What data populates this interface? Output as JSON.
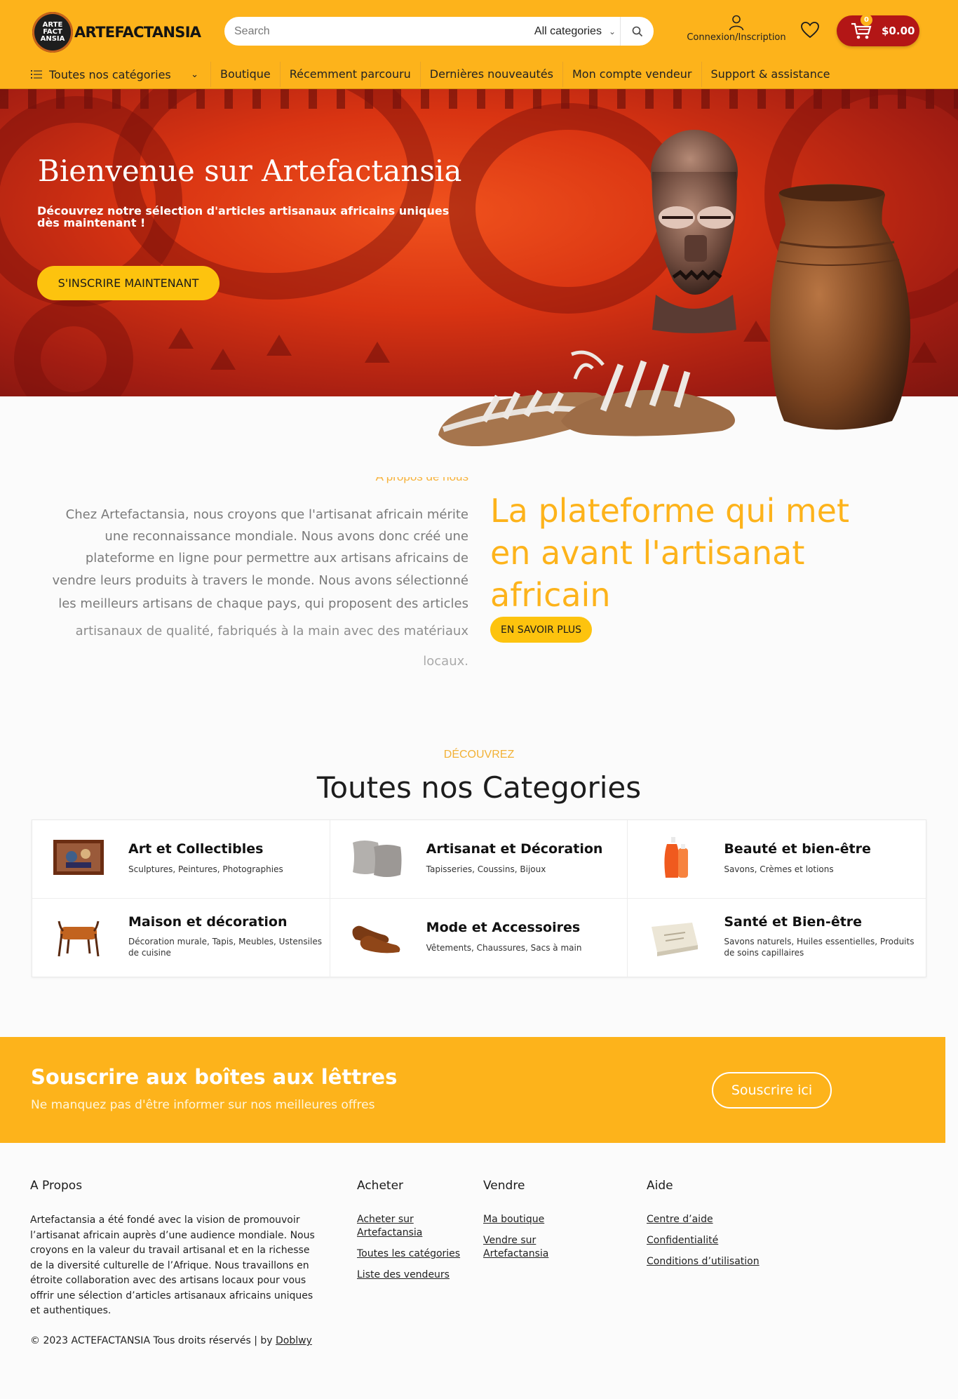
{
  "header": {
    "logo_text": "ARTEFACTANSIA",
    "logo_badge": [
      "ARTE",
      "FACT",
      "ANSIA"
    ],
    "search_placeholder": "Search",
    "category_select": "All categories",
    "account_label": "Connexion/Inscription",
    "cart_count": "0",
    "cart_amount": "$0.00",
    "colors": {
      "brand_yellow": "#fdb31b",
      "cart_red": "#b31616"
    }
  },
  "nav": {
    "all_categories": "Toutes nos catégories",
    "links": [
      "Boutique",
      "Récemment parcouru",
      "Dernières nouveautés",
      "Mon compte vendeur",
      "Support & assistance"
    ]
  },
  "hero": {
    "title": "Bienvenue sur Artefactansia",
    "subtitle": "Découvrez notre sélection d'articles artisanaux africains uniques dès maintenant !",
    "cta": "S'INSCRIRE MAINTENANT"
  },
  "about": {
    "label": "A propos de nous",
    "paragraph_lines": [
      "Chez Artefactansia, nous croyons que l'artisanat africain mérite",
      "une reconnaissance mondiale. Nous avons donc créé une",
      "plateforme en ligne pour permettre aux artisans africains de",
      "vendre leurs produits à travers le monde. Nous avons sélectionné",
      "les meilleurs artisans de chaque pays, qui proposent des articles",
      "artisanaux de qualité, fabriqués à la main avec des matériaux",
      "locaux."
    ],
    "heading": "La plateforme qui met en avant l'artisanat africain",
    "cta": "EN SAVOIR PLUS"
  },
  "categories": {
    "kicker": "DÉCOUVREZ",
    "title": "Toutes nos Categories",
    "items": [
      {
        "name": "Art et Collectibles",
        "desc": "Sculptures, Peintures, Photographies",
        "icon": "painting-icon"
      },
      {
        "name": "Artisanat et Décoration",
        "desc": "Tapisseries, Coussins, Bijoux",
        "icon": "cushions-icon"
      },
      {
        "name": "Beauté et bien-être",
        "desc": "Savons, Crèmes et lotions",
        "icon": "lotion-bottles-icon"
      },
      {
        "name": "Maison et décoration",
        "desc": "Décoration murale, Tapis, Meubles, Ustensiles de cuisine",
        "icon": "bench-icon"
      },
      {
        "name": "Mode et Accessoires",
        "desc": "Vêtements, Chaussures, Sacs à main",
        "icon": "shoes-icon"
      },
      {
        "name": "Santé et Bien-être",
        "desc": "Savons naturels, Huiles essentielles, Produits de soins capillaires",
        "icon": "soap-bar-icon"
      }
    ]
  },
  "newsletter": {
    "title": "Souscrire aux boîtes aux lêttres",
    "subtitle": "Ne manquez pas d'être informer sur nos meilleures offres",
    "cta": "Souscrire ici"
  },
  "footer": {
    "about_title": "A Propos",
    "about_text": "Artefactansia a été fondé avec la vision de promouvoir l’artisanat africain auprès d’une audience mondiale. Nous croyons en la valeur du travail artisanal et en la richesse de la diversité culturelle de l’Afrique. Nous travaillons en étroite collaboration avec des artisans locaux pour vous offrir une sélection d’articles artisanaux africains uniques et authentiques.",
    "columns": [
      {
        "title": "Acheter",
        "links": [
          "Acheter sur Artefactansia",
          "Toutes les catégories",
          "Liste des vendeurs"
        ]
      },
      {
        "title": "Vendre",
        "links": [
          "Ma boutique",
          "Vendre sur Artefactansia"
        ]
      },
      {
        "title": "Aide",
        "links": [
          "Centre d’aide",
          "Confidentialité",
          "Conditions d’utilisation"
        ]
      }
    ],
    "copyright": "© 2023 ACTEFACTANSIA  Tous droits réservés | by ",
    "credit": "Doblwy"
  }
}
